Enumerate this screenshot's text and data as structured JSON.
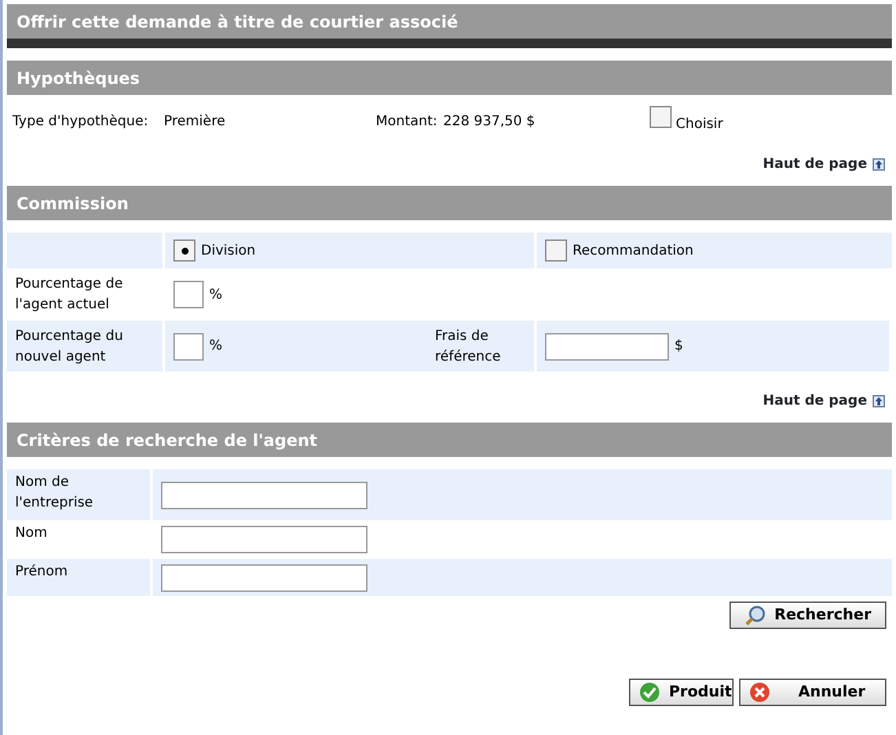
{
  "window": {
    "title": "Offrir cette demande à titre de courtier associé"
  },
  "mortgages": {
    "header": "Hypothèques",
    "type_label": "Type d'hypothèque:",
    "type_value": "Première",
    "amount_label": "Montant:",
    "amount_value": "228 937,50 $",
    "choose": {
      "label": "Choisir",
      "checked": false
    }
  },
  "back_to_top_1": "Haut de page",
  "commission": {
    "header": "Commission",
    "options": [
      {
        "label": "Division",
        "selected": true
      },
      {
        "label": "Recommandation",
        "selected": false
      }
    ],
    "current_agent": {
      "label": "Pourcentage de l'agent actuel",
      "unit": "%"
    },
    "new_agent": {
      "label": "Pourcentage du nouvel agent",
      "unit": "%"
    },
    "referral_fee": {
      "label": "Frais de référence",
      "unit": "$"
    }
  },
  "back_to_top_2": "Haut de page",
  "search": {
    "header": "Critères de recherche de l'agent",
    "fields": [
      {
        "label": "Nom de l'entreprise"
      },
      {
        "label": "Nom"
      },
      {
        "label": "Prénom"
      }
    ],
    "button": "Rechercher"
  },
  "buttons": [
    {
      "kind": "ok",
      "label": "Produit"
    },
    {
      "kind": "cancel",
      "label": "Annuler"
    }
  ]
}
